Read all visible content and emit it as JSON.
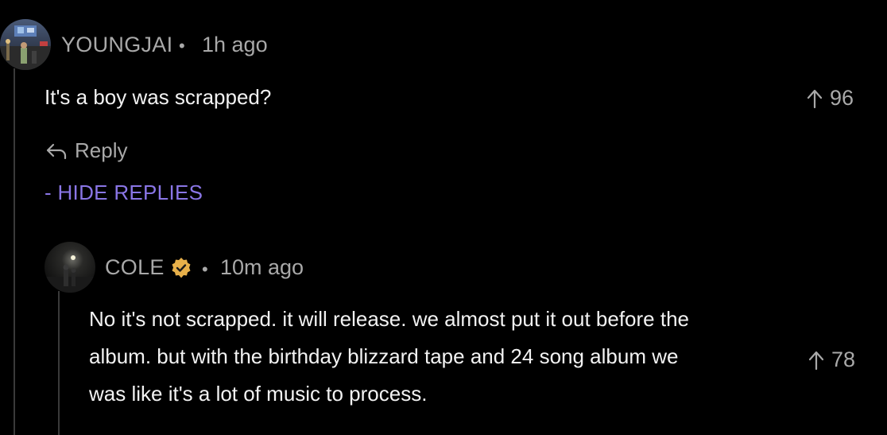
{
  "comment": {
    "username": "YOUNGJAI",
    "separator": "•",
    "time": "1h ago",
    "body": "It's a boy was scrapped?",
    "upvotes": "96",
    "reply_label": "Reply",
    "hide_replies_label": "- HIDE REPLIES"
  },
  "reply": {
    "username": "COLE",
    "separator": "•",
    "time": "10m ago",
    "body_lines": [
      "No it's not scrapped. it will release. we almost put it out before the",
      "album. but with the birthday blizzard tape and 24 song album we",
      "was like it's a lot of music to process."
    ],
    "upvotes": "78",
    "verified_color": "#e7b04a"
  },
  "colors": {
    "background": "#000000",
    "muted_text": "#a9a9a9",
    "accent": "#8a76e6"
  }
}
